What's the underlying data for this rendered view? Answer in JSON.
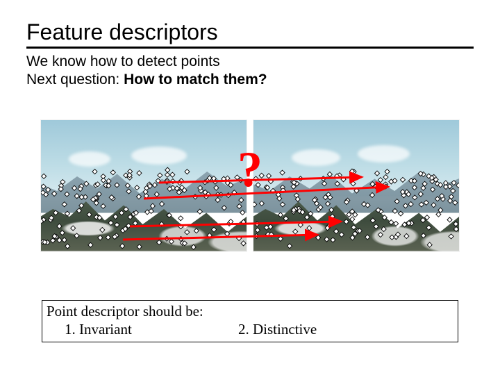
{
  "title": "Feature descriptors",
  "line1": "We know how to detect points",
  "line2_prefix": "Next question: ",
  "line2_bold": "How to match them?",
  "qmark": "?",
  "box_title": "Point descriptor should be:",
  "box_item1": "1.   Invariant",
  "box_item2": "2.   Distinctive"
}
